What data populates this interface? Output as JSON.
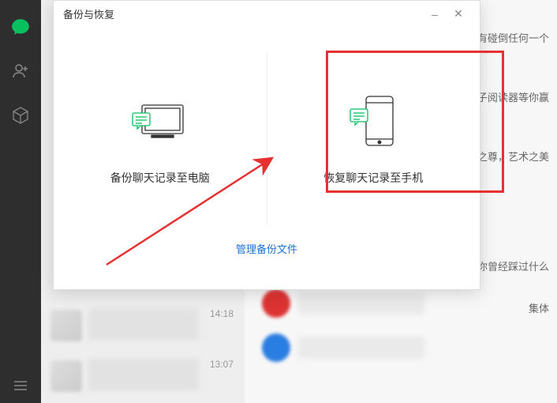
{
  "dialog": {
    "title": "备份与恢复",
    "option_backup": "备份聊天记录至电脑",
    "option_restore": "恢复聊天记录至手机",
    "manage_link": "管理备份文件"
  },
  "chat": {
    "item1_time": "14:18",
    "item2_time": "13:07"
  },
  "right_text": {
    "line1": "然没有碰倒任何一个",
    "line2": "子阅读器等你赢",
    "line3": "之尊，艺术之美",
    "line4": "程中你曾经踩过什么",
    "line5": "集体"
  },
  "rail": {
    "chat_icon": "chat-bubble",
    "contacts_icon": "add-contact",
    "cube_icon": "cube",
    "menu_icon": "menu"
  }
}
